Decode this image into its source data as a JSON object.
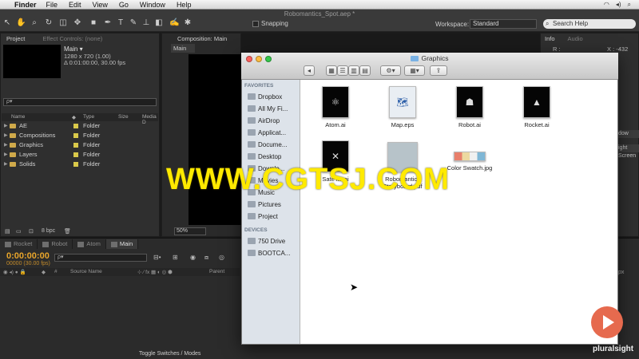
{
  "menubar": {
    "app_name": "Finder",
    "items": [
      "File",
      "Edit",
      "View",
      "Go",
      "Window",
      "Help"
    ]
  },
  "ae": {
    "document_title": "Robomantics_Spot.aep *",
    "snapping_label": "Snapping",
    "workspace_label": "Workspace:",
    "workspace_value": "Standard",
    "search_help_placeholder": "Search Help"
  },
  "project_panel": {
    "tab_project": "Project",
    "tab_effect_controls": "Effect Controls: (none)",
    "selected_name": "Main ▾",
    "selected_dims": "1280 x 720 (1.00)",
    "selected_duration": "Δ 0:01:00:00, 30.00 fps",
    "search_placeholder": "ρ▾",
    "columns": [
      "Name",
      "Type",
      "Size",
      "Media D"
    ],
    "rows": [
      {
        "name": "AE",
        "type": "Folder"
      },
      {
        "name": "Compositions",
        "type": "Folder"
      },
      {
        "name": "Graphics",
        "type": "Folder"
      },
      {
        "name": "Layers",
        "type": "Folder"
      },
      {
        "name": "Solids",
        "type": "Folder"
      }
    ],
    "bpc": "8 bpc"
  },
  "comp_panel": {
    "tab": "Composition: Main",
    "subtab": "Main",
    "zoom": "50%"
  },
  "info_panel": {
    "tab_info": "Info",
    "tab_audio": "Audio",
    "r_label": "R :",
    "x_value": "X : -432",
    "strip_labels": [
      "dow",
      "ight Screen",
      "px"
    ]
  },
  "timeline": {
    "tabs": [
      "Rocket",
      "Robot",
      "Atom",
      "Main"
    ],
    "active_tab": "Main",
    "current_time": "0:00:00:00",
    "frames": "00000 (30.00 fps)",
    "search_placeholder": "ρ▾",
    "col_source_name": "Source Name",
    "col_parent": "Parent",
    "toggle_label": "Toggle Switches / Modes"
  },
  "finder": {
    "title": "Graphics",
    "sidebar_favorites_header": "FAVORITES",
    "favorites": [
      "Dropbox",
      "All My Fi...",
      "AirDrop",
      "Applicat...",
      "Docume...",
      "Desktop",
      "Downlo...",
      "Movies",
      "Music",
      "Pictures",
      "Project"
    ],
    "sidebar_devices_header": "DEVICES",
    "devices": [
      "750 Drive",
      "BOOTCA..."
    ],
    "files": [
      {
        "name": "Atom.ai",
        "kind": "ai",
        "glyph": "⚛"
      },
      {
        "name": "Map.eps",
        "kind": "map",
        "glyph": "🗺"
      },
      {
        "name": "Robot.ai",
        "kind": "ai",
        "glyph": "☗"
      },
      {
        "name": "Rocket.ai",
        "kind": "ai",
        "glyph": "▲"
      },
      {
        "name": "Sate   ite.ai",
        "kind": "ai",
        "glyph": "✕"
      },
      {
        "name": "Robomantics Storyboard.pdf",
        "kind": "board",
        "glyph": ""
      },
      {
        "name": "Color Swatch.jpg",
        "kind": "swatch",
        "glyph": ""
      }
    ]
  },
  "overlay": {
    "watermark": "WWW.CGTSJ.COM",
    "brand": "pluralsight"
  },
  "colors": {
    "timecode": "#e8a52b",
    "folder_label": "#d9c94a",
    "finder_sidebar": "#dde3ea",
    "brand": "#e66a4e"
  }
}
